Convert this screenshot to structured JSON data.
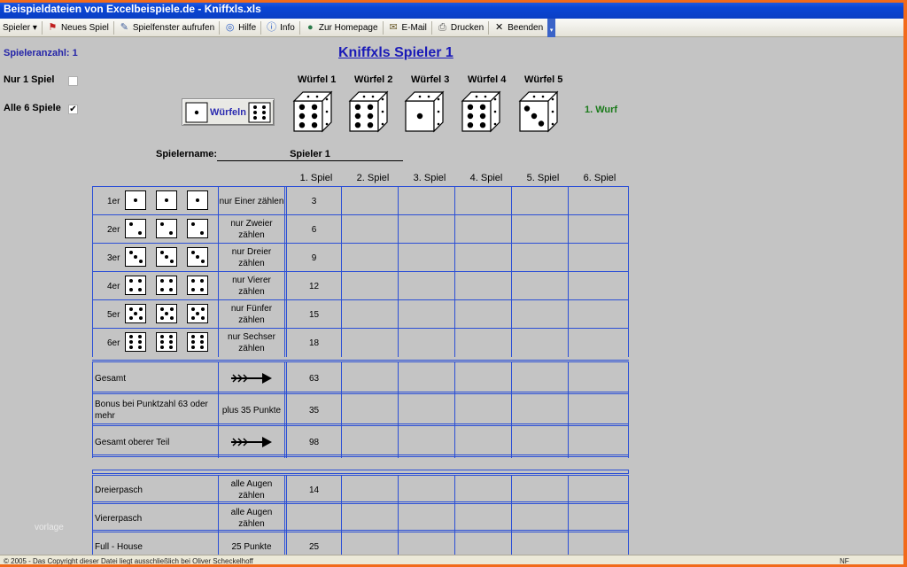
{
  "window": {
    "title": "Beispieldateien von Excelbeispiele.de - Kniffxls.xls"
  },
  "toolbar": {
    "items": [
      {
        "label": "Spieler ▾",
        "icon": ""
      },
      {
        "label": "Neues Spiel",
        "icon": "flag-icon"
      },
      {
        "label": "Spielfenster aufrufen",
        "icon": "edit-icon"
      },
      {
        "label": "Hilfe",
        "icon": "help-icon"
      },
      {
        "label": "Info",
        "icon": "info-icon"
      },
      {
        "label": "Zur Homepage",
        "icon": "globe-icon"
      },
      {
        "label": "E-Mail",
        "icon": "mail-icon"
      },
      {
        "label": "Drucken",
        "icon": "printer-icon"
      },
      {
        "label": "Beenden",
        "icon": "close-icon"
      }
    ]
  },
  "sheet": {
    "players_count": "Spieleranzahl: 1",
    "title": "Kniffxls Spieler 1",
    "option1": {
      "label": "Nur 1 Spiel",
      "checked": false
    },
    "option2": {
      "label": "Alle 6 Spiele",
      "checked": true
    },
    "roll_button": "Würfeln",
    "dice_headers": [
      "Würfel 1",
      "Würfel 2",
      "Würfel 3",
      "Würfel 4",
      "Würfel 5"
    ],
    "dice_values": [
      6,
      6,
      1,
      6,
      3
    ],
    "throw_count": "1. Wurf",
    "player_name_label": "Spielername:",
    "player_name": "Spieler 1",
    "game_columns": [
      "1. Spiel",
      "2. Spiel",
      "3. Spiel",
      "4. Spiel",
      "5. Spiel",
      "6. Spiel"
    ]
  },
  "upper": {
    "rows": [
      {
        "label": "1er",
        "face": 1,
        "desc": "nur Einer zählen",
        "value": "3"
      },
      {
        "label": "2er",
        "face": 2,
        "desc": "nur Zweier zählen",
        "value": "6"
      },
      {
        "label": "3er",
        "face": 3,
        "desc": "nur Dreier zählen",
        "value": "9"
      },
      {
        "label": "4er",
        "face": 4,
        "desc": "nur Vierer zählen",
        "value": "12"
      },
      {
        "label": "5er",
        "face": 5,
        "desc": "nur Fünfer zählen",
        "value": "15"
      },
      {
        "label": "6er",
        "face": 6,
        "desc": "nur Sechser zählen",
        "value": "18"
      }
    ],
    "total": {
      "label": "Gesamt",
      "value": "63"
    },
    "bonus": {
      "label": "Bonus bei Punktzahl 63 oder mehr",
      "desc": "plus 35 Punkte",
      "value": "35"
    },
    "upper_total": {
      "label": "Gesamt oberer Teil",
      "value": "98"
    }
  },
  "lower": {
    "rows": [
      {
        "label": "Dreierpasch",
        "desc": "alle Augen zählen",
        "value": "14"
      },
      {
        "label": "Viererpasch",
        "desc": "alle Augen zählen",
        "value": ""
      },
      {
        "label": "Full - House",
        "desc": "25 Punkte",
        "value": "25"
      }
    ]
  },
  "watermark": "vorlage",
  "statusbar": {
    "copyright": "© 2005 - Das Copyright dieser Datei liegt ausschließlich bei Oliver Scheckelhoff",
    "mode": "NF"
  },
  "colors": {
    "grid": "#2b4fd6",
    "title": "#1a1ab8",
    "throw": "#1a7a1a",
    "frame": "#f26a1b"
  }
}
